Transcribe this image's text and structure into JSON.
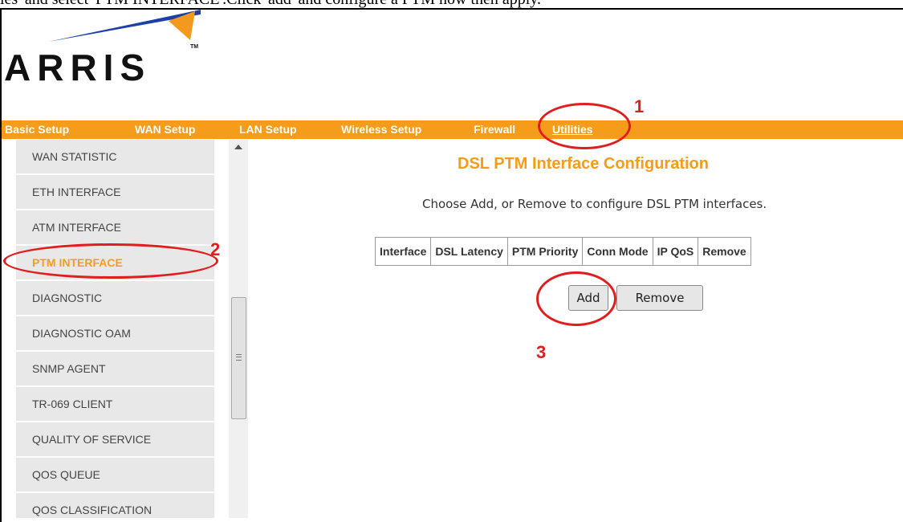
{
  "instruction": "ies' and select 'PTM INTERFACE'.Click 'add' and configure a PTM now then apply.",
  "logo": {
    "text": "ARRIS",
    "trademark": "TM"
  },
  "nav": [
    {
      "label": "Basic Setup"
    },
    {
      "label": "WAN Setup"
    },
    {
      "label": "LAN Setup"
    },
    {
      "label": "Wireless Setup"
    },
    {
      "label": "Firewall"
    },
    {
      "label": "Utilities",
      "active": true
    }
  ],
  "sidebar": [
    {
      "label": "WAN STATISTIC"
    },
    {
      "label": "ETH INTERFACE"
    },
    {
      "label": "ATM INTERFACE"
    },
    {
      "label": "PTM INTERFACE",
      "active": true
    },
    {
      "label": "DIAGNOSTIC"
    },
    {
      "label": "DIAGNOSTIC OAM"
    },
    {
      "label": "SNMP AGENT"
    },
    {
      "label": "TR-069 CLIENT"
    },
    {
      "label": "QUALITY OF SERVICE"
    },
    {
      "label": "QOS QUEUE"
    },
    {
      "label": "QOS CLASSIFICATION"
    }
  ],
  "main": {
    "title": "DSL PTM Interface Configuration",
    "description": "Choose Add, or Remove to configure DSL PTM interfaces.",
    "table_headers": [
      "Interface",
      "DSL Latency",
      "PTM Priority",
      "Conn Mode",
      "IP QoS",
      "Remove"
    ],
    "add_label": "Add",
    "remove_label": "Remove"
  },
  "annotations": {
    "step1": "1",
    "step2": "2",
    "step3": "3"
  },
  "colors": {
    "accent": "#f59c1a",
    "annotation": "#e01e1e",
    "logo_blue": "#1f3fa8",
    "logo_orange": "#f39a1e"
  }
}
